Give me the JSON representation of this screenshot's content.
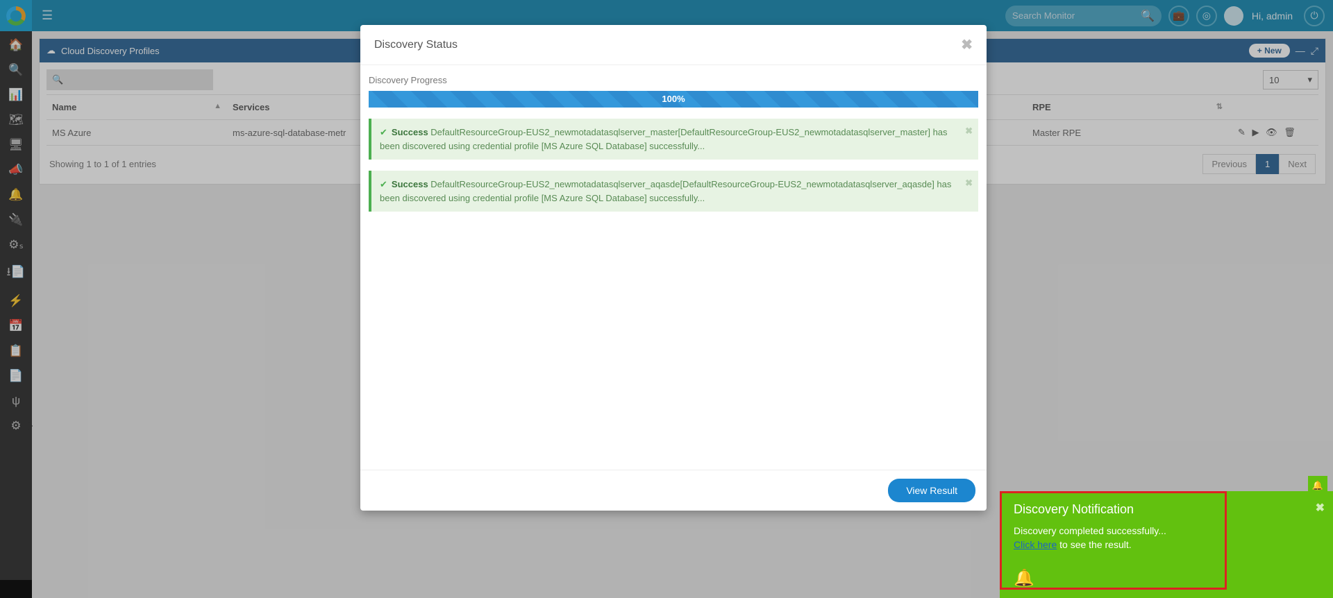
{
  "topbar": {
    "search_placeholder": "Search Monitor",
    "greeting": "Hi, admin"
  },
  "sidebar_icons": [
    "home",
    "search",
    "dashboard",
    "network",
    "monitor",
    "announce",
    "bell",
    "plug",
    "processes",
    "doc-down",
    "bolt",
    "calendar",
    "clipboard",
    "file",
    "branch",
    "gear"
  ],
  "panel": {
    "title": "Cloud Discovery Profiles",
    "new_label": "+ New",
    "page_size": "10",
    "columns": {
      "name": "Name",
      "services": "Services",
      "rpe": "RPE"
    },
    "rows": [
      {
        "name": "MS Azure",
        "services": "ms-azure-sql-database-metr",
        "rpe": "Master RPE"
      }
    ],
    "showing": "Showing 1 to 1 of 1 entries",
    "pager": {
      "prev": "Previous",
      "current": "1",
      "next": "Next"
    }
  },
  "modal": {
    "title": "Discovery Status",
    "progress_label": "Discovery Progress",
    "progress_pct": "100%",
    "alerts": [
      {
        "status": "Success",
        "message": "DefaultResourceGroup-EUS2_newmotadatasqlserver_master[DefaultResourceGroup-EUS2_newmotadatasqlserver_master] has been discovered using credential profile [MS Azure SQL Database] successfully..."
      },
      {
        "status": "Success",
        "message": "DefaultResourceGroup-EUS2_newmotadatasqlserver_aqasde[DefaultResourceGroup-EUS2_newmotadatasqlserver_aqasde] has been discovered using credential profile [MS Azure SQL Database] successfully..."
      }
    ],
    "view_result": "View Result"
  },
  "toast": {
    "title": "Discovery Notification",
    "message": "Discovery completed successfully...",
    "link_text": "Click here",
    "suffix": " to see the result."
  }
}
